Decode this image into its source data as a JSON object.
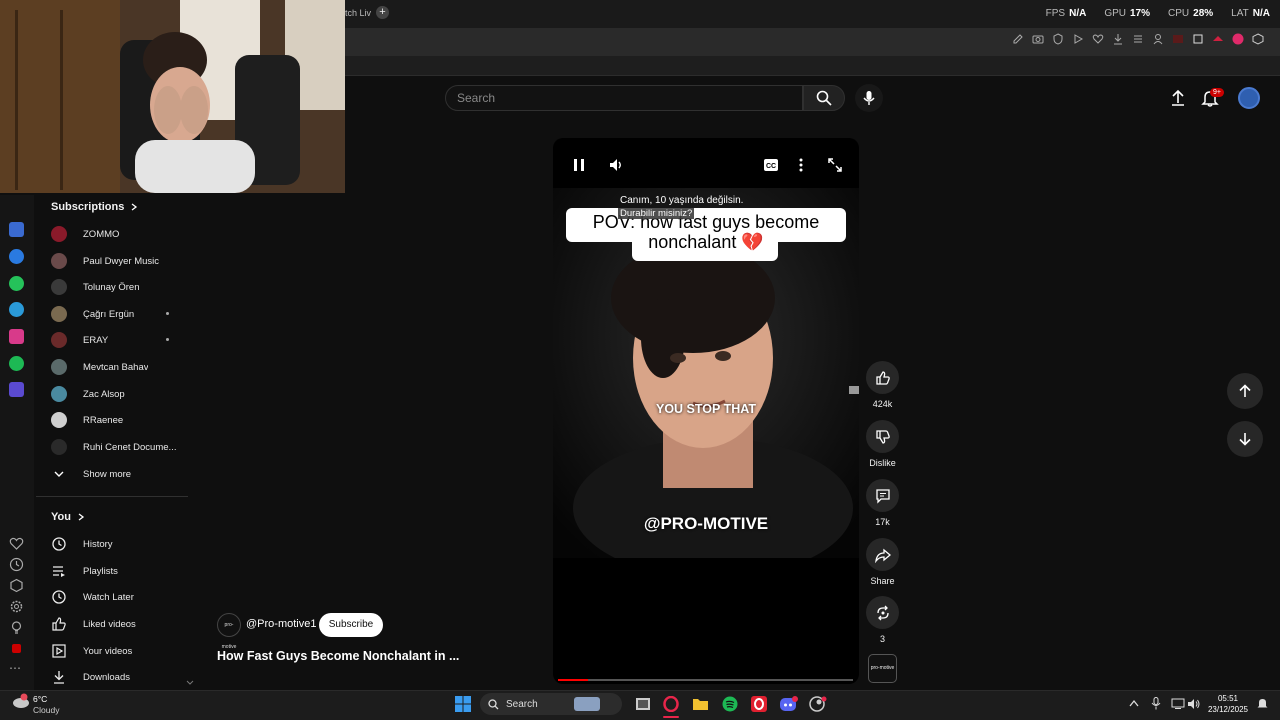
{
  "browser": {
    "tab_title": "atch Liv",
    "perf": [
      {
        "label": "FPS",
        "value": "N/A"
      },
      {
        "label": "GPU",
        "value": "17%"
      },
      {
        "label": "CPU",
        "value": "28%"
      },
      {
        "label": "LAT",
        "value": "N/A"
      }
    ]
  },
  "header": {
    "search_placeholder": "Search",
    "notification_count": "9+"
  },
  "sidebar": {
    "subscriptions_title": "Subscriptions",
    "subscriptions": [
      {
        "name": "ZOMMO",
        "color": "#8a1a2a",
        "dot": false
      },
      {
        "name": "Paul Dwyer Music",
        "color": "#6a4a4a",
        "dot": false
      },
      {
        "name": "Tolunay Ören",
        "color": "#3a3a3a",
        "dot": false
      },
      {
        "name": "Çağrı Ergün",
        "color": "#7a6a50",
        "dot": true
      },
      {
        "name": "ERAY",
        "color": "#6a2a2a",
        "dot": true
      },
      {
        "name": "Mevtcan Bahav",
        "color": "#5a6a6a",
        "dot": false
      },
      {
        "name": "Zac Alsop",
        "color": "#4a8aa0",
        "dot": false
      },
      {
        "name": "RRaenee",
        "color": "#cfcfcf",
        "dot": false
      },
      {
        "name": "Ruhi Cenet Docume...",
        "color": "#2a2a2a",
        "dot": false
      }
    ],
    "show_more": "Show more",
    "you_title": "You",
    "you_items": [
      {
        "label": "History",
        "icon": "history-icon"
      },
      {
        "label": "Playlists",
        "icon": "playlists-icon"
      },
      {
        "label": "Watch Later",
        "icon": "watch-later-icon"
      },
      {
        "label": "Liked videos",
        "icon": "liked-videos-icon"
      },
      {
        "label": "Your videos",
        "icon": "your-videos-icon"
      },
      {
        "label": "Downloads",
        "icon": "downloads-icon"
      }
    ]
  },
  "short": {
    "subtitle_line1": "Canım, 10 yaşında değilsin.",
    "subtitle_line2": "Durabilir misiniz?",
    "caption": "POV: how fast guys become nonchalant 💔",
    "overlay_text": "YOU STOP THAT",
    "watermark": "@PRO-MOTIVE",
    "progress": 0.1,
    "channel_name": "@Pro-motive1",
    "channel_avatar_text": "pro-motive",
    "subscribe_label": "Subscribe",
    "title": "How Fast Guys Become Nonchalant in ..."
  },
  "actions": {
    "like_count": "424k",
    "dislike_label": "Dislike",
    "comments_count": "17k",
    "share_label": "Share",
    "remix_count": "3"
  },
  "taskbar": {
    "temperature": "6°C",
    "weather": "Cloudy",
    "search_label": "Search",
    "time": "05:51",
    "date": "23/12/2025"
  }
}
